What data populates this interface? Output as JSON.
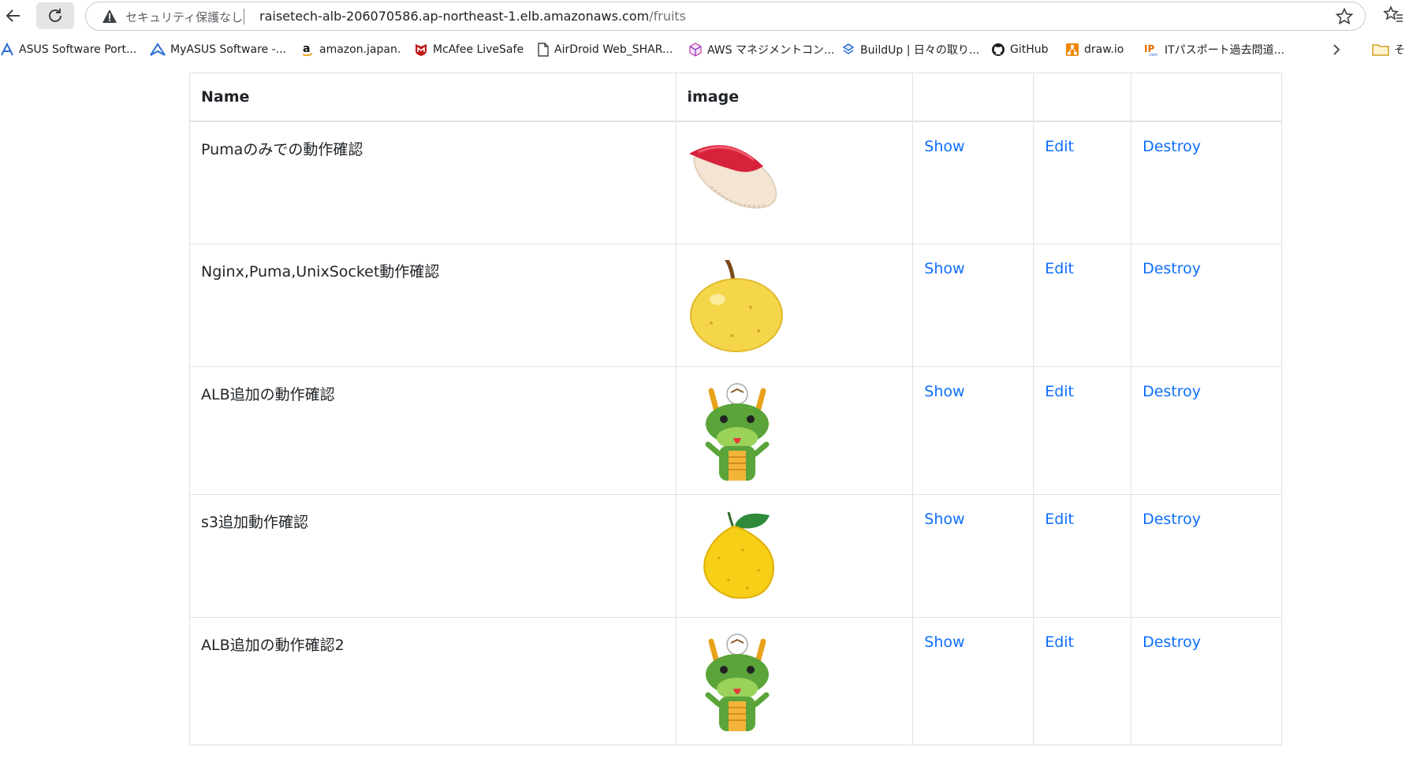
{
  "browser": {
    "security_label": "セキュリティ保護なし",
    "url_host": "raisetech-alb-206070586.ap-northeast-1.elb.amazonaws.com",
    "url_path": "/fruits"
  },
  "bookmarks": [
    {
      "label": "ASUS Software Port...",
      "icon": "asus-icon"
    },
    {
      "label": "MyASUS Software -...",
      "icon": "myasus-icon"
    },
    {
      "label": "amazon.japan.",
      "icon": "amazon-icon"
    },
    {
      "label": "McAfee LiveSafe",
      "icon": "mcafee-icon"
    },
    {
      "label": "AirDroid Web_SHAR...",
      "icon": "document-icon"
    },
    {
      "label": "AWS マネジメントコン...",
      "icon": "aws-cube-icon"
    },
    {
      "label": "BuildUp | 日々の取り...",
      "icon": "buildup-icon"
    },
    {
      "label": "GitHub",
      "icon": "github-icon"
    },
    {
      "label": "draw.io",
      "icon": "drawio-icon"
    },
    {
      "label": "ITパスポート過去問道...",
      "icon": "itpassport-icon"
    }
  ],
  "bookmark_folder": "そ",
  "table": {
    "headers": {
      "name": "Name",
      "image": "image"
    },
    "rows": [
      {
        "name": "Pumaのみでの動作確認",
        "image": "sushi-icon",
        "show": "Show",
        "edit": "Edit",
        "destroy": "Destroy"
      },
      {
        "name": "Nginx,Puma,UnixSocket動作確認",
        "image": "pear-icon",
        "show": "Show",
        "edit": "Edit",
        "destroy": "Destroy"
      },
      {
        "name": "ALB追加の動作確認",
        "image": "dragon-icon",
        "show": "Show",
        "edit": "Edit",
        "destroy": "Destroy"
      },
      {
        "name": "s3追加動作確認",
        "image": "yuzu-icon",
        "show": "Show",
        "edit": "Edit",
        "destroy": "Destroy"
      },
      {
        "name": "ALB追加の動作確認2",
        "image": "dragon-icon",
        "show": "Show",
        "edit": "Edit",
        "destroy": "Destroy"
      }
    ]
  },
  "colors": {
    "link": "#0d6efd",
    "border": "#dee2e6"
  }
}
